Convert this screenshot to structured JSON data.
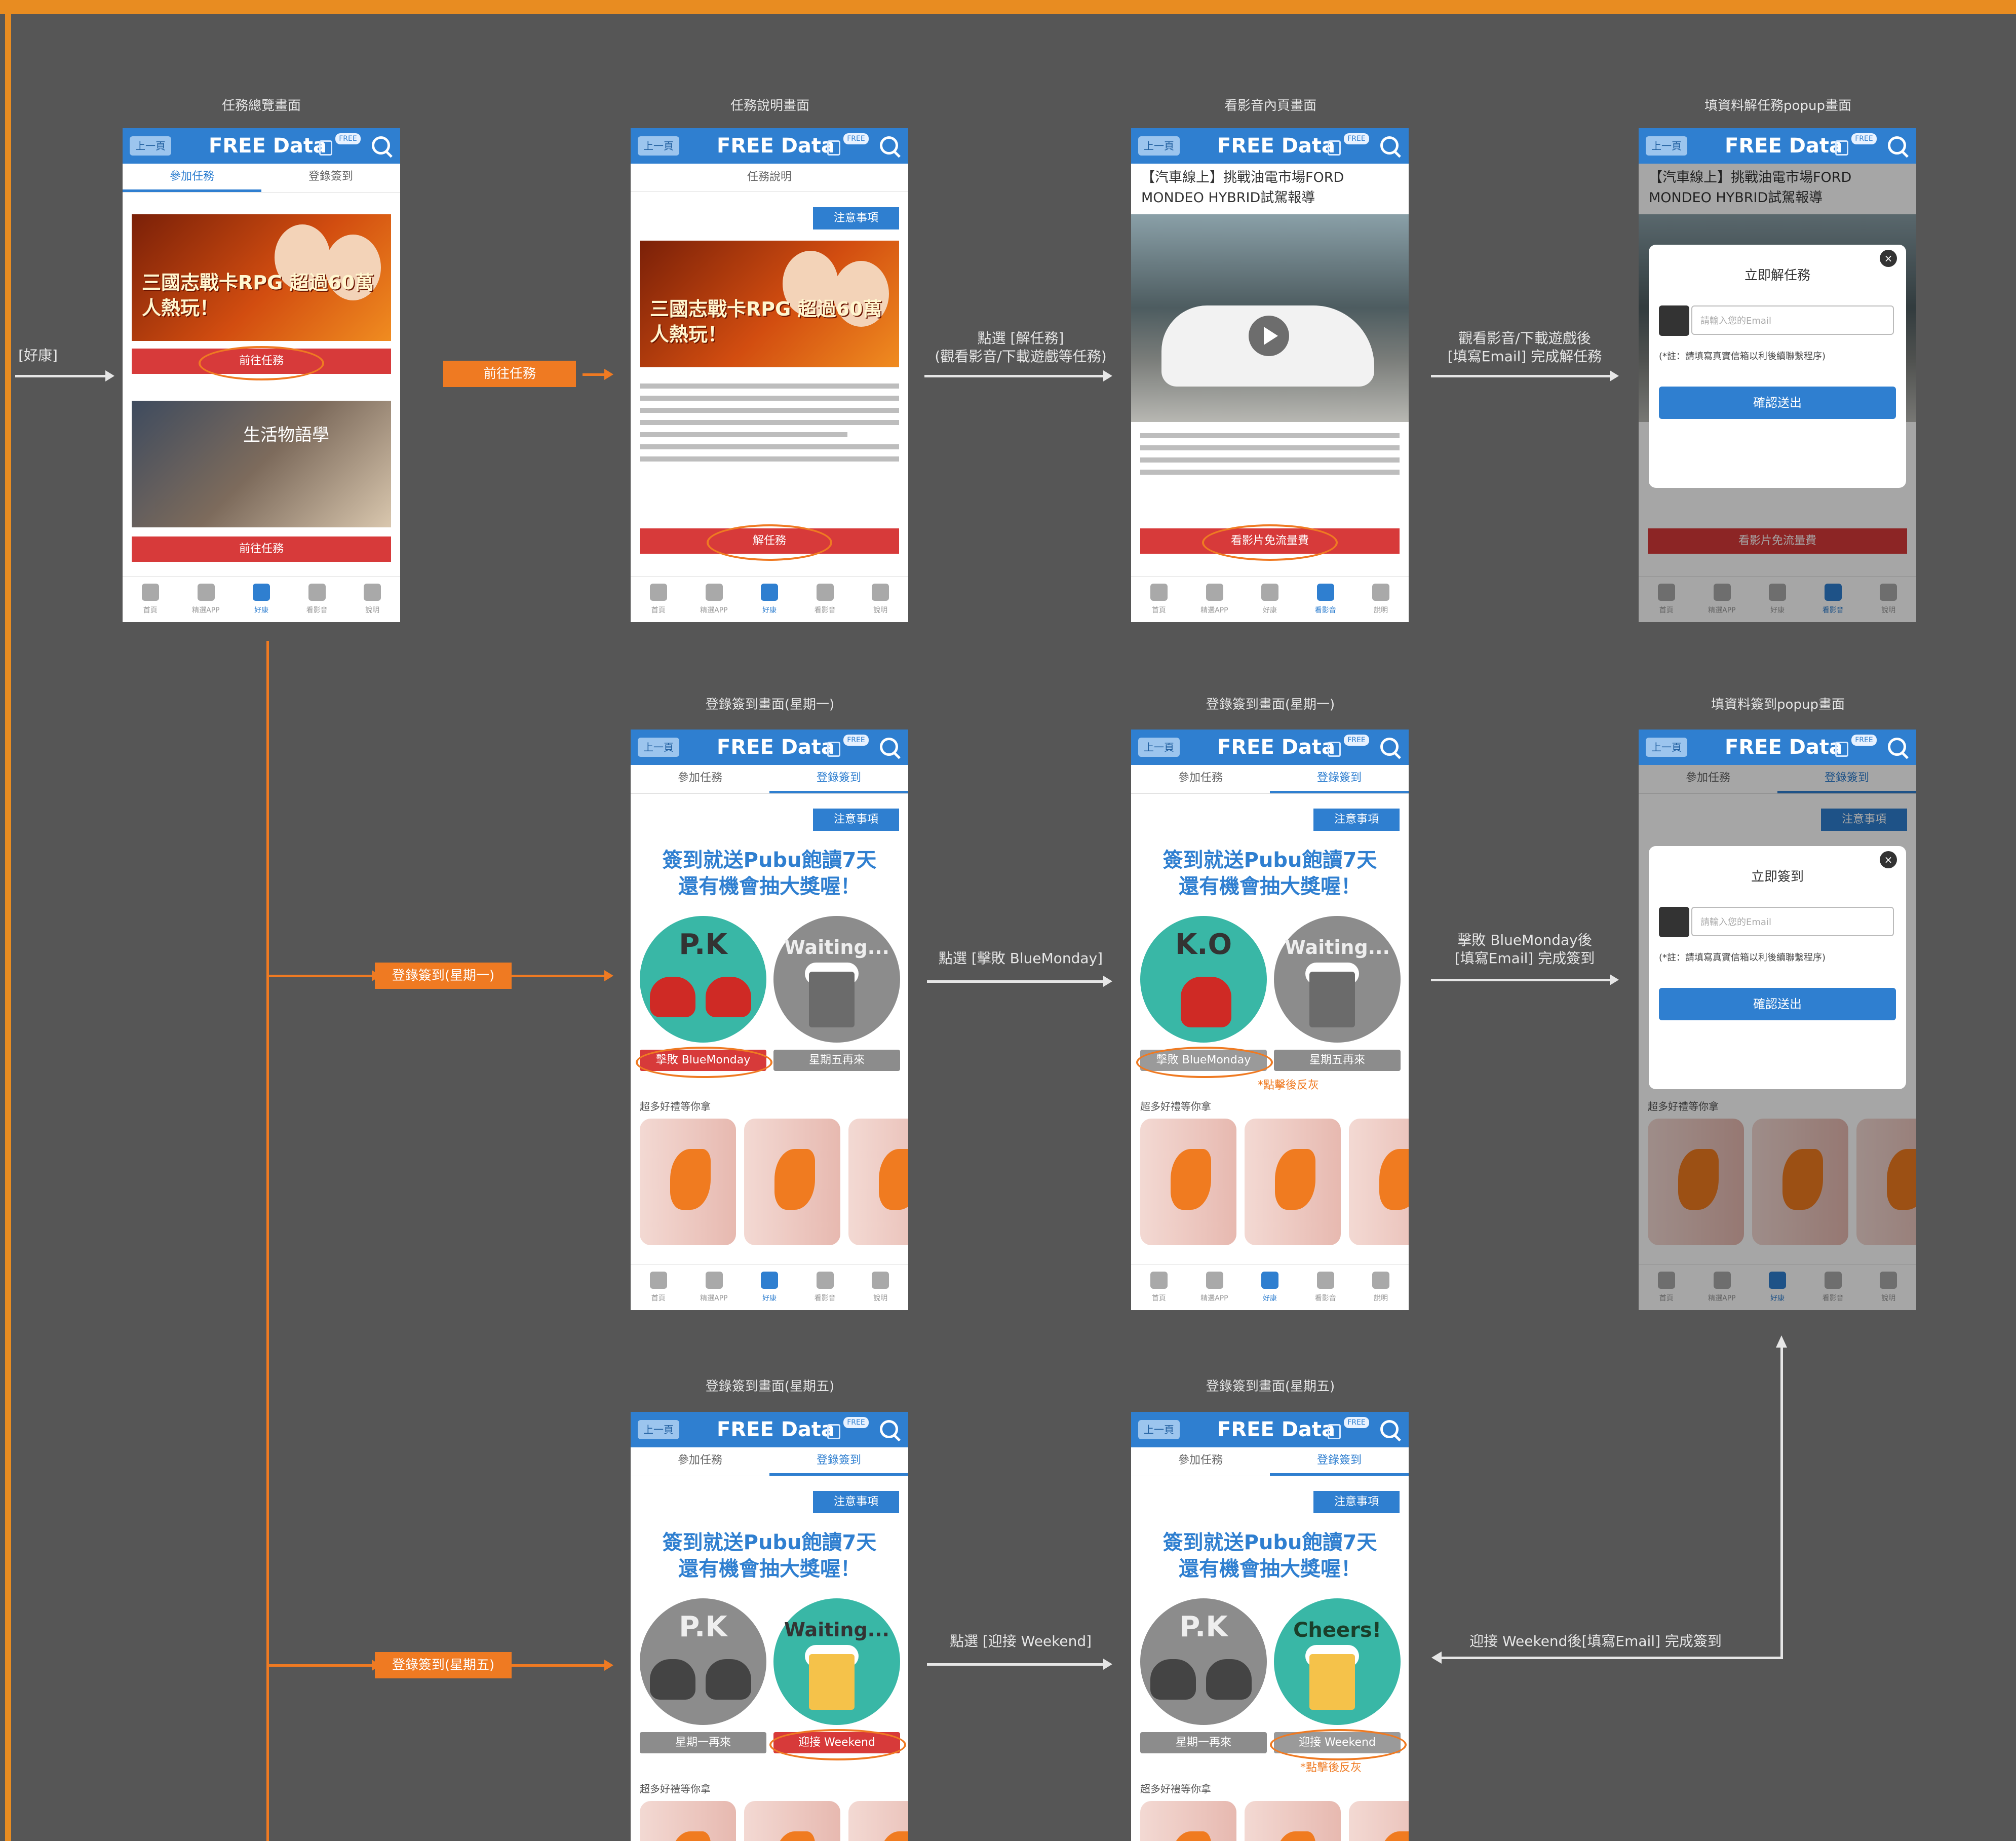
{
  "screens": {
    "s1": {
      "title": "任務總覽畫面"
    },
    "s2": {
      "title": "任務說明畫面"
    },
    "s3": {
      "title": "看影音內頁畫面"
    },
    "s4": {
      "title": "填資料解任務popup畫面"
    },
    "s5": {
      "title": "登錄簽到畫面(星期一)"
    },
    "s6": {
      "title": "登錄簽到畫面(星期一)"
    },
    "s7": {
      "title": "填資料簽到popup畫面"
    },
    "s8": {
      "title": "登錄簽到畫面(星期五)"
    },
    "s9": {
      "title": "登錄簽到畫面(星期五)"
    }
  },
  "app": {
    "back": "上一頁",
    "title": "FREE Data",
    "free_badge": "FREE",
    "tab_join": "參加任務",
    "tab_checkin": "登錄簽到",
    "notice": "注意事項",
    "task_desc": "任務說明",
    "nav": [
      "首頁",
      "精選APP",
      "好康",
      "看影音",
      "說明"
    ]
  },
  "overview": {
    "banner1_text": "三國志戰卡RPG 超過60萬人熱玩！",
    "banner2_text": "生活物語學",
    "btn_go": "前往任務"
  },
  "desc_screen": {
    "btn_solve": "解任務"
  },
  "video_screen": {
    "video_title": "【汽車線上】挑戰油電市場FORD MONDEO HYBRID試駕報導",
    "btn_watch": "看影片免流量費"
  },
  "popup": {
    "title_solve": "立即解任務",
    "title_checkin": "立即簽到",
    "email_placeholder": "請輸入您的Email",
    "note": "(*註：請填寫真實信箱以利後續聯繫程序)",
    "confirm": "確認送出",
    "close": "×"
  },
  "checkin": {
    "headline_1": "簽到就送Pubu飽讀7天",
    "headline_2": "還有機會抽大獎喔！",
    "pk": "P.K",
    "ko": "K.O",
    "waiting": "Waiting...",
    "cheers": "Cheers!",
    "beat_monday": "擊敗 BlueMonday",
    "fri_again": "星期五再來",
    "mon_again": "星期一再來",
    "welcome_weekend": "迎接 Weekend",
    "prizes": "超多好禮等你拿",
    "clicked_grey": "*點擊後反灰"
  },
  "flow": {
    "label_entry": "[好康]",
    "label_go_task": "前往任務",
    "label_solve": "點選 [解任務]\n(觀看影音/下載遊戲等任務)",
    "label_email_done": "觀看影音/下載遊戲後\n[填寫Email] 完成解任務",
    "label_checkin_mon": "登錄簽到(星期一)",
    "label_click_monday": "點選 [擊敗 BlueMonday]",
    "label_monday_email": "擊敗 BlueMonday後\n[填寫Email] 完成簽到",
    "label_checkin_fri": "登錄簽到(星期五)",
    "label_click_weekend": "點選 [迎接 Weekend]",
    "label_weekend_email": "迎接 Weekend後[填寫Email] 完成簽到"
  },
  "colors": {
    "accent": "#2f7fd0",
    "flow_orange": "#ef7a22",
    "button_red": "#d73a3a",
    "background": "#565656"
  }
}
